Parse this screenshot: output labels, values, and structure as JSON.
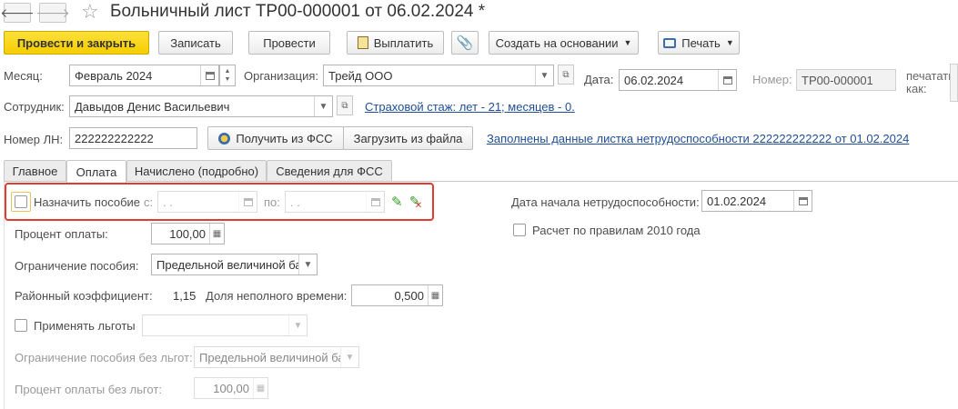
{
  "window": {
    "title": "Больничный лист ТР00-000001 от 06.02.2024 *",
    "back_icon": "arrow-left-icon",
    "forward_icon": "arrow-right-icon",
    "favorite_icon": "star-icon"
  },
  "toolbar": {
    "post_close": "Провести и закрыть",
    "save": "Записать",
    "post": "Провести",
    "pay": "Выплатить",
    "attach_icon": "paperclip-icon",
    "create_based": "Создать на основании",
    "print": "Печать"
  },
  "header": {
    "month_label": "Месяц:",
    "month_value": "Февраль 2024",
    "org_label": "Организация:",
    "org_value": "Трейд ООО",
    "date_label": "Дата:",
    "date_value": "06.02.2024",
    "number_label": "Номер:",
    "number_value": "ТР00-000001",
    "print_as": "печатать как:",
    "employee_label": "Сотрудник:",
    "employee_value": "Давыдов Денис Васильевич",
    "insurance_link": "Страховой стаж: лет - 21; месяцев - 0.",
    "ln_label": "Номер ЛН:",
    "ln_value": "222222222222",
    "get_fss": "Получить из ФСС",
    "load_file": "Загрузить из файла",
    "filled_link": "Заполнены данные листка нетрудоспособности 222222222222 от 01.02.2024"
  },
  "tabs": [
    {
      "label": "Главное"
    },
    {
      "label": "Оплата"
    },
    {
      "label": "Начислено (подробно)"
    },
    {
      "label": "Сведения для ФСС"
    }
  ],
  "payment": {
    "assign_label": "Назначить пособие",
    "from_label": "с:",
    "from_value": " .  .",
    "to_label": "по:",
    "to_value": " .  .",
    "start_label": "Дата начала нетрудоспособности:",
    "start_value": "01.02.2024",
    "rules_2010": "Расчет по правилам 2010 года",
    "percent_label": "Процент оплаты:",
    "percent_value": "100,00",
    "limit_label": "Ограничение пособия:",
    "limit_value": "Предельной величиной ба",
    "district_label": "Районный коэффициент:",
    "district_value": "1,15",
    "parttime_label": "Доля неполного времени:",
    "parttime_value": "0,500",
    "benefits_label": "Применять льготы",
    "benefits_value": "",
    "limit_nobenefit_label": "Ограничение пособия без льгот:",
    "limit_nobenefit_value": "Предельной величиной ба",
    "percent_nobenefit_label": "Процент оплаты без льгот:",
    "percent_nobenefit_value": "100,00"
  }
}
